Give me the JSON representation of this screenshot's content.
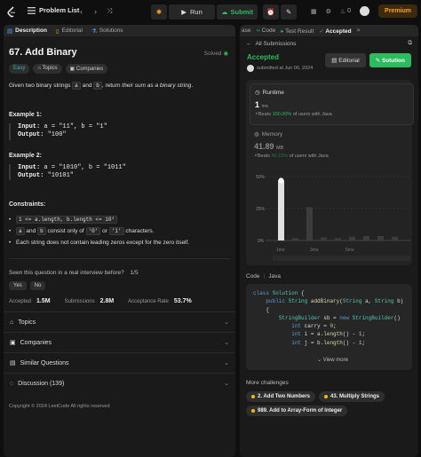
{
  "topbar": {
    "list_label": "Problem List",
    "run_label": "Run",
    "submit_label": "Submit",
    "streak": "0",
    "premium_label": "Premium"
  },
  "left": {
    "tabs": [
      {
        "label": "Description"
      },
      {
        "label": "Editorial"
      },
      {
        "label": "Solutions"
      }
    ],
    "title": "67. Add Binary",
    "solved": "Solved",
    "tags": {
      "difficulty": "Easy",
      "topics": "Topics",
      "companies": "Companies"
    },
    "desc": {
      "a": "Given two binary strings ",
      "var_a": "a",
      "and": " and ",
      "var_b": "b",
      "b": ", return ",
      "em": "their sum as a binary string",
      "end": "."
    },
    "examples": [
      {
        "head": "Example 1:",
        "input_label": "Input:",
        "input": " a = \"11\", b = \"1\"",
        "output_label": "Output:",
        "output": " \"100\""
      },
      {
        "head": "Example 2:",
        "input_label": "Input:",
        "input": " a = \"1010\", b = \"1011\"",
        "output_label": "Output:",
        "output": " \"10101\""
      }
    ],
    "constraints_head": "Constraints:",
    "constraints": {
      "c1": "1 <= a.length, b.length <= 10⁴",
      "c2_a": "a",
      "c2_and": " and ",
      "c2_b": "b",
      "c2_mid": " consist only of ",
      "c2_zero": "'0'",
      "c2_or": " or ",
      "c2_one": "'1'",
      "c2_end": " characters.",
      "c3": "Each string does not contain leading zeros except for the zero itself."
    },
    "seen": "Seen this question in a real interview before?",
    "seen_page": "1/5",
    "yes": "Yes",
    "no": "No",
    "stats": {
      "accepted_label": "Accepted",
      "accepted": "1.5M",
      "subs_label": "Submissions",
      "subs": "2.8M",
      "rate_label": "Acceptance Rate",
      "rate": "53.7%"
    },
    "accordions": [
      {
        "label": "Topics"
      },
      {
        "label": "Companies"
      },
      {
        "label": "Similar Questions"
      },
      {
        "label": "Discussion (139)"
      }
    ],
    "copyright": "Copyright © 2024 LeetCode All rights reserved"
  },
  "right": {
    "tabs": [
      {
        "label": "ase"
      },
      {
        "label": "Code"
      },
      {
        "label": "Test Result"
      },
      {
        "label": "Accepted"
      }
    ],
    "all_subs": "All Submissions",
    "status": "Accepted",
    "submitted": "submitted at Jun 06, 2024",
    "editorial_btn": "Editorial",
    "solution_btn": "Solution",
    "runtime_label": "Runtime",
    "runtime_value": "1",
    "runtime_unit": "ms",
    "runtime_beats_pre": "Beats ",
    "runtime_beats": "100.00%",
    "runtime_beats_post": " of users with Java",
    "memory_label": "Memory",
    "memory_value": "41.89",
    "memory_unit": "MB",
    "memory_beats_pre": "Beats ",
    "memory_beats": "45.15%",
    "memory_beats_post": " of users with Java",
    "chart_ticks": [
      "50%",
      "25%",
      "0%"
    ],
    "chart_xlabels": [
      "1ms",
      "3ms",
      "5ms"
    ],
    "chart_bar_fractions": [
      0.94,
      0.04,
      0.52,
      0.05,
      0.04,
      0.06,
      0.07,
      0.07,
      0.06
    ],
    "code_label": "Code",
    "code_lang": "Java",
    "code_lines": [
      "class Solution {",
      "    public String addBinary(String a, String b)",
      "    {",
      "        StringBuilder sb = new StringBuilder()",
      "            int carry = 0;",
      "            int i = a.length() - 1;",
      "            int j = b.length() - 1;"
    ],
    "view_more": "View more",
    "more_label": "More challenges",
    "challenges": [
      {
        "label": "2. Add Two Numbers"
      },
      {
        "label": "43. Multiply Strings"
      },
      {
        "label": "989. Add to Array-Form of Integer"
      }
    ]
  }
}
